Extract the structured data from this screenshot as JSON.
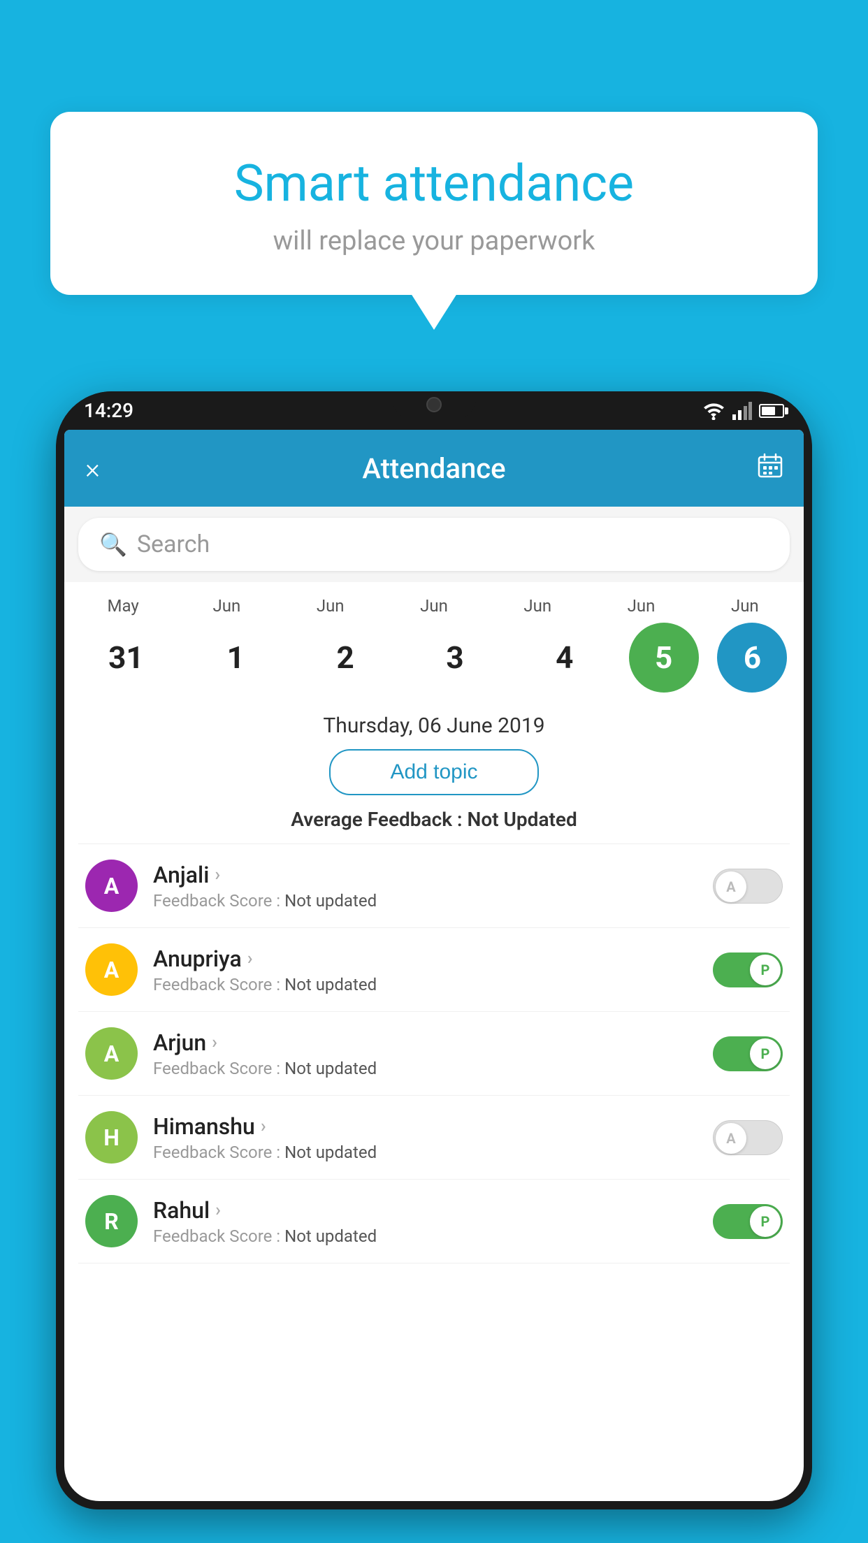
{
  "background_color": "#17b3e0",
  "bubble": {
    "title": "Smart attendance",
    "subtitle": "will replace your paperwork"
  },
  "phone": {
    "time": "14:29",
    "header": {
      "title": "Attendance",
      "close_label": "×",
      "calendar_label": "📅"
    },
    "search": {
      "placeholder": "Search"
    },
    "date_picker": {
      "months": [
        "May",
        "Jun",
        "Jun",
        "Jun",
        "Jun",
        "Jun",
        "Jun"
      ],
      "days": [
        "31",
        "1",
        "2",
        "3",
        "4",
        "5",
        "6"
      ],
      "today_index": 5,
      "selected_index": 6
    },
    "selected_date_label": "Thursday, 06 June 2019",
    "add_topic_label": "Add topic",
    "avg_feedback_label": "Average Feedback :",
    "avg_feedback_value": "Not Updated",
    "students": [
      {
        "name": "Anjali",
        "initial": "A",
        "avatar_color": "#9c27b0",
        "feedback_label": "Feedback Score :",
        "feedback_value": "Not updated",
        "toggle": "off",
        "toggle_letter": "A"
      },
      {
        "name": "Anupriya",
        "initial": "A",
        "avatar_color": "#ffc107",
        "feedback_label": "Feedback Score :",
        "feedback_value": "Not updated",
        "toggle": "on",
        "toggle_letter": "P"
      },
      {
        "name": "Arjun",
        "initial": "A",
        "avatar_color": "#8bc34a",
        "feedback_label": "Feedback Score :",
        "feedback_value": "Not updated",
        "toggle": "on",
        "toggle_letter": "P"
      },
      {
        "name": "Himanshu",
        "initial": "H",
        "avatar_color": "#8bc34a",
        "feedback_label": "Feedback Score :",
        "feedback_value": "Not updated",
        "toggle": "off",
        "toggle_letter": "A"
      },
      {
        "name": "Rahul",
        "initial": "R",
        "avatar_color": "#4caf50",
        "feedback_label": "Feedback Score :",
        "feedback_value": "Not updated",
        "toggle": "on",
        "toggle_letter": "P"
      }
    ]
  }
}
